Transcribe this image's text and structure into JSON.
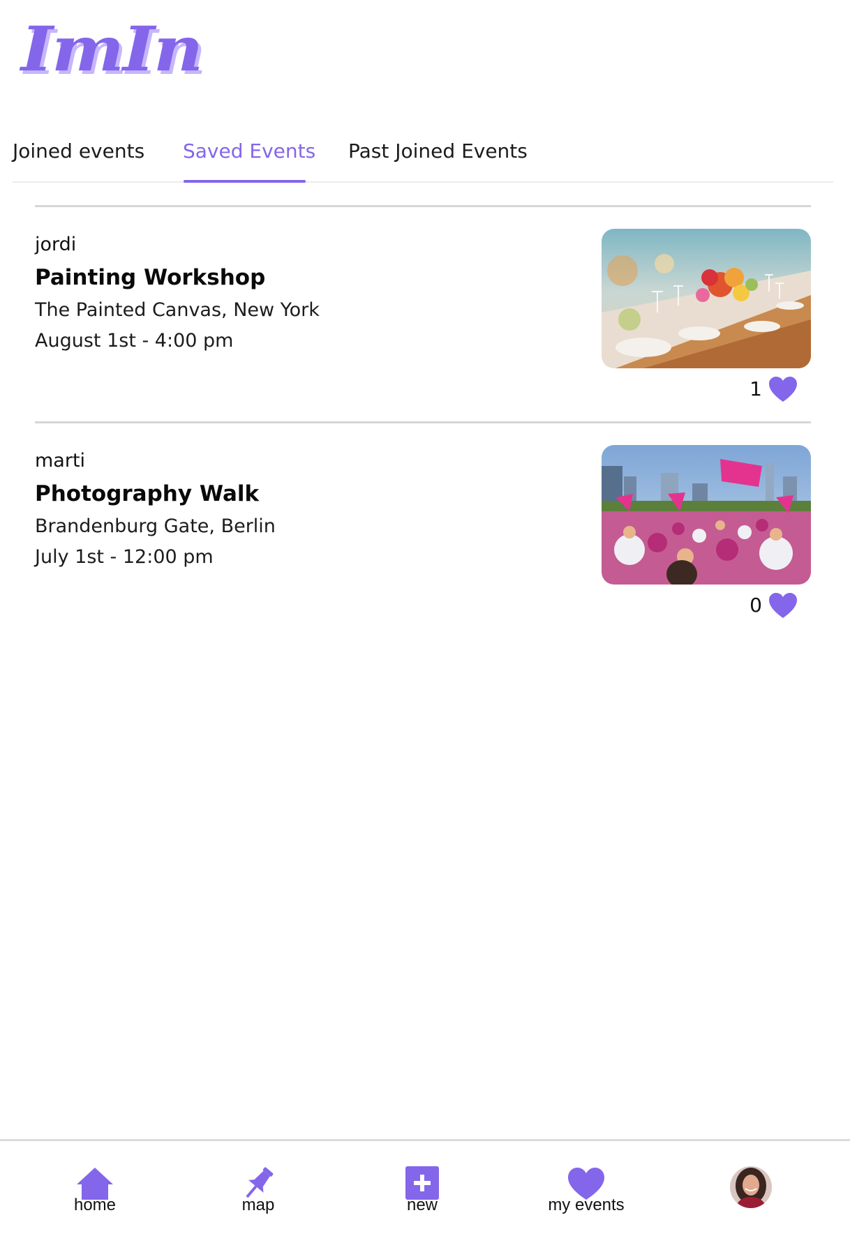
{
  "app": {
    "logo": "ImIn"
  },
  "tabs": [
    {
      "label": "Joined events",
      "active": false
    },
    {
      "label": "Saved Events",
      "active": true
    },
    {
      "label": "Past Joined Events",
      "active": false
    }
  ],
  "events": [
    {
      "user": "jordi",
      "title": "Painting Workshop",
      "place": "The Painted Canvas, New York",
      "when": "August 1st - 4:00 pm",
      "likes": "1",
      "image": "banquet-table-photo"
    },
    {
      "user": "marti",
      "title": "Photography Walk",
      "place": "Brandenburg Gate, Berlin",
      "when": "July 1st - 12:00 pm",
      "likes": "0",
      "image": "pink-crowd-rally-photo"
    }
  ],
  "nav": {
    "home": "home",
    "map": "map",
    "new": "new",
    "my_events": "my events"
  },
  "colors": {
    "accent": "#8466ea",
    "accent_light": "#c6b6fb",
    "divider": "#d6d6d6"
  },
  "icons": [
    "home-icon",
    "pin-icon",
    "plus-square-icon",
    "heart-icon",
    "avatar"
  ]
}
